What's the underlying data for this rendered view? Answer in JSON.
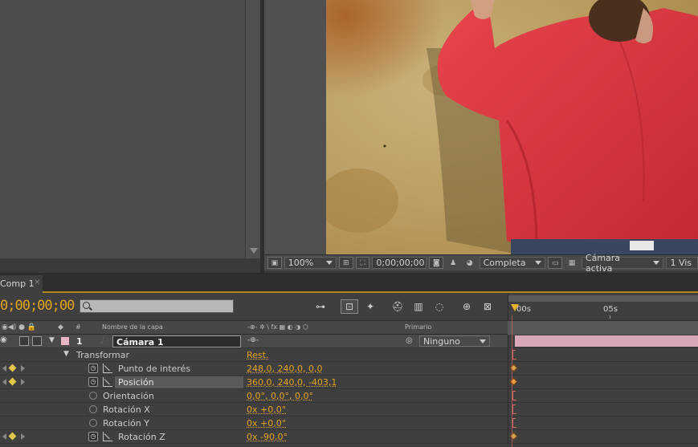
{
  "viewer": {
    "zoom": "100%",
    "timecode": "0;00;00;00",
    "resolution": "Completa",
    "view": "Cámara activa",
    "views_count": "1 Vis"
  },
  "timeline": {
    "tab_label": "Comp 1",
    "tab_close": "×",
    "current_time": "0;00;00;00",
    "ruler_start": "00s",
    "ruler_mark": "05s",
    "columns": {
      "number": "#",
      "layer_name": "Nombre de la capa",
      "switches": "-⊕- ✲ \\ fx ▦ ◐ ◑ ⬡",
      "parent": "Primario"
    },
    "layer": {
      "index": "1",
      "name": "Cámara 1",
      "parent": "Ninguno"
    },
    "transform": {
      "label": "Transformar",
      "reset": "Rest."
    },
    "properties": [
      {
        "name": "Punto de interés",
        "value": "248,0, 240,0, 0,0"
      },
      {
        "name": "Posición",
        "value": "360,0, 240,0, -403,1"
      },
      {
        "name": "Orientación",
        "value": "0,0°, 0,0°, 0,0°"
      },
      {
        "name": "Rotación X",
        "value": "0x +0,0°"
      },
      {
        "name": "Rotación Y",
        "value": "0x +0,0°"
      },
      {
        "name": "Rotación Z",
        "value": "0x -90,0°"
      }
    ]
  },
  "colors": {
    "accent": "#e4a41c",
    "label_pink": "#e8b6c2",
    "layer_bar": "#d8a8b4"
  }
}
